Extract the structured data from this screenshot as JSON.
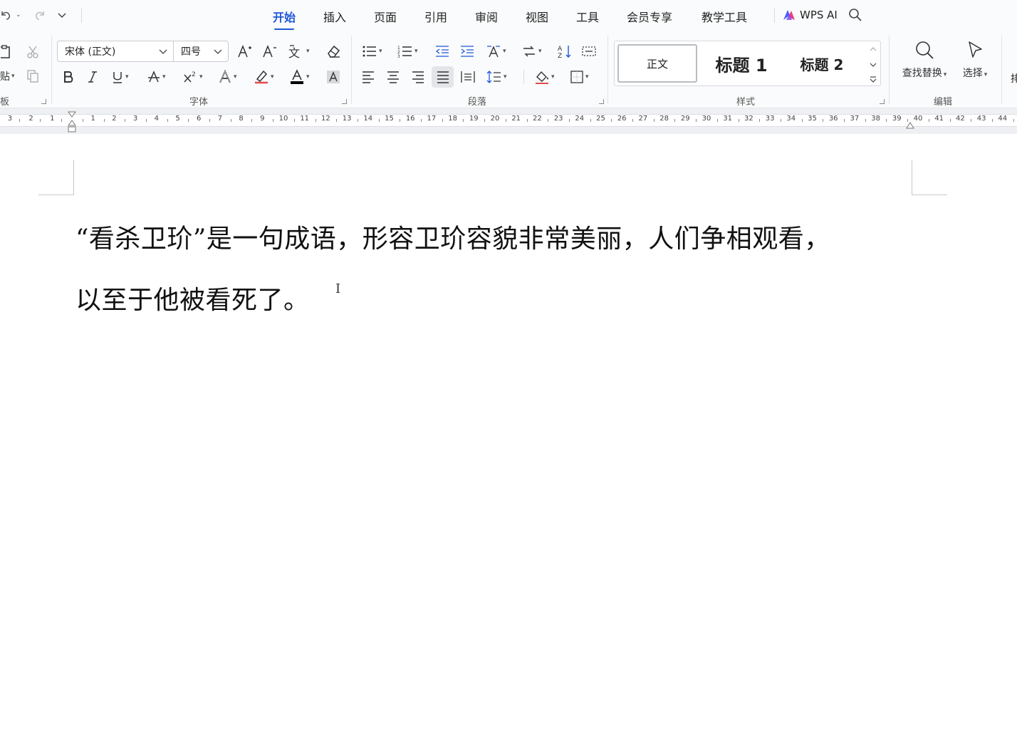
{
  "quick_access": {
    "undo_icon": "undo-icon",
    "redo_icon": "redo-icon",
    "more_icon": "chevron-down-icon"
  },
  "tabs": [
    {
      "label": "开始",
      "active": true
    },
    {
      "label": "插入"
    },
    {
      "label": "页面"
    },
    {
      "label": "引用"
    },
    {
      "label": "审阅"
    },
    {
      "label": "视图"
    },
    {
      "label": "工具"
    },
    {
      "label": "会员专享"
    },
    {
      "label": "教学工具"
    }
  ],
  "wps_ai": {
    "label": "WPS AI",
    "icon": "wps-ai-logo-icon"
  },
  "search_icon": "search-icon",
  "ribbon": {
    "clipboard": {
      "paste_label": "贴",
      "group_label": "板"
    },
    "font": {
      "font_name": "宋体 (正文)",
      "font_size": "四号",
      "group_label": "字体",
      "color_accent": "#000000"
    },
    "paragraph": {
      "group_label": "段落"
    },
    "styles": {
      "items": [
        "正文",
        "标题 1",
        "标题 2"
      ],
      "group_label": "样式"
    },
    "editing": {
      "find_replace_label": "查找替换",
      "select_label": "选择",
      "group_label": "编辑",
      "cut_off_label": "排"
    }
  },
  "ruler": {
    "left_numbers": [
      "3",
      "2",
      "1"
    ],
    "right_numbers": [
      "1",
      "2",
      "3",
      "4",
      "5",
      "6",
      "7",
      "8",
      "9",
      "10",
      "11",
      "12",
      "13",
      "14",
      "15",
      "16",
      "17",
      "18",
      "19",
      "20",
      "21",
      "22",
      "23",
      "24",
      "25",
      "26",
      "27",
      "28",
      "29",
      "30",
      "31",
      "32",
      "33",
      "34",
      "35",
      "36",
      "37",
      "38",
      "39",
      "40",
      "41",
      "42",
      "43",
      "44"
    ]
  },
  "document": {
    "line1": "“看杀卫玠”是一句成语，形容卫玠容貌非常美丽，人们争相观看，",
    "line2": "以至于他被看死了。",
    "cursor": "I"
  },
  "colors": {
    "accent": "#1f56d8",
    "background": "#fafbfc"
  }
}
